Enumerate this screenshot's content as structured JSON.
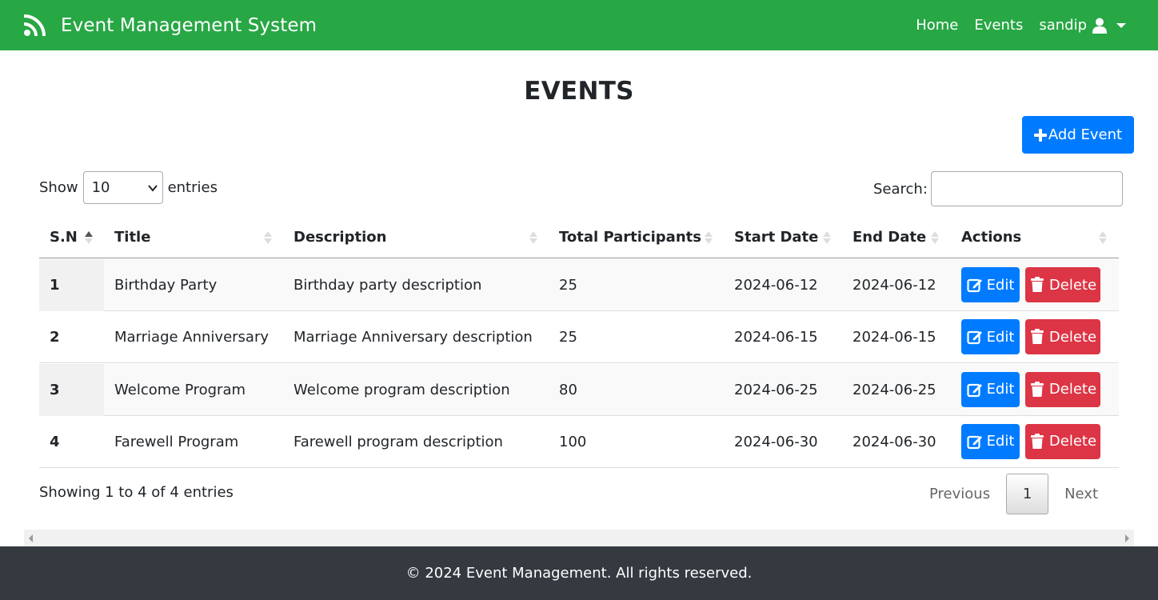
{
  "navbar": {
    "brand": "Event Management System",
    "brand_icon": "feed-icon",
    "links": {
      "home": "Home",
      "events": "Events",
      "user": "sandip"
    },
    "color": "#28a745"
  },
  "page": {
    "title": "EVENTS",
    "add_button": "Add Event"
  },
  "controls": {
    "show_label": "Show",
    "entries_value": "10",
    "entries_label": "entries",
    "search_label": "Search:",
    "search_value": ""
  },
  "table": {
    "headers": [
      "S.N",
      "Title",
      "Description",
      "Total Participants",
      "Start Date",
      "End Date",
      "Actions"
    ],
    "sorted_column": "S.N",
    "rows": [
      {
        "sn": "1",
        "title": "Birthday Party",
        "description": "Birthday party description",
        "participants": "25",
        "start": "2024-06-12",
        "end": "2024-06-12"
      },
      {
        "sn": "2",
        "title": "Marriage Anniversary",
        "description": "Marriage Anniversary description",
        "participants": "25",
        "start": "2024-06-15",
        "end": "2024-06-15"
      },
      {
        "sn": "3",
        "title": "Welcome Program",
        "description": "Welcome program description",
        "participants": "80",
        "start": "2024-06-25",
        "end": "2024-06-25"
      },
      {
        "sn": "4",
        "title": "Farewell Program",
        "description": "Farewell program description",
        "participants": "100",
        "start": "2024-06-30",
        "end": "2024-06-30"
      }
    ],
    "edit_label": "Edit",
    "delete_label": "Delete",
    "edit_color": "#007bff",
    "delete_color": "#dc3545"
  },
  "pagination": {
    "info": "Showing 1 to 4 of 4 entries",
    "previous": "Previous",
    "current": "1",
    "next": "Next"
  },
  "footer": {
    "text": "© 2024 Event Management. All rights reserved.",
    "color": "#343a40"
  }
}
